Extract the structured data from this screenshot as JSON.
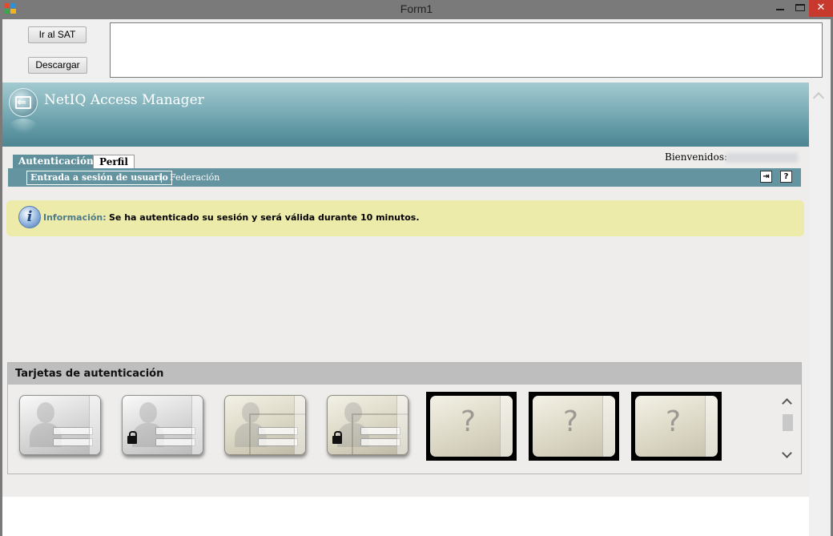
{
  "window": {
    "title": "Form1",
    "close_glyph": "✕"
  },
  "form": {
    "btn_sat_label": "Ir al SAT",
    "btn_descargar_label": "Descargar",
    "textbox_value": ""
  },
  "portal": {
    "app_title": "NetIQ Access Manager",
    "tabs": [
      {
        "label": "Autenticación",
        "active": true
      },
      {
        "label": "Perfil",
        "active": false
      }
    ],
    "welcome_label": "Bienvenidos:",
    "subtabs": [
      {
        "label": "Entrada a sesión de usuario",
        "active": true
      },
      {
        "label": "Federación",
        "active": false
      }
    ],
    "logout_icon": "logout-icon",
    "help_icon": "help-icon",
    "help_glyph": "?",
    "info": {
      "icon": "info-icon",
      "icon_glyph": "i",
      "label": "Información:",
      "message": "Se ha autenticado su sesión y será válida durante 10 minutos."
    },
    "cards_panel": {
      "title": "Tarjetas de autenticación",
      "card_icons": [
        "user-card-icon",
        "user-card-locked-icon",
        "user-doc-card-icon",
        "user-doc-card-locked-icon",
        "unknown-card-icon",
        "unknown-card-icon",
        "unknown-card-icon"
      ],
      "unknown_glyph": "?"
    }
  },
  "colors": {
    "header_teal": "#6494a0",
    "info_bg": "#ecebaa",
    "close_red": "#c7392c"
  }
}
